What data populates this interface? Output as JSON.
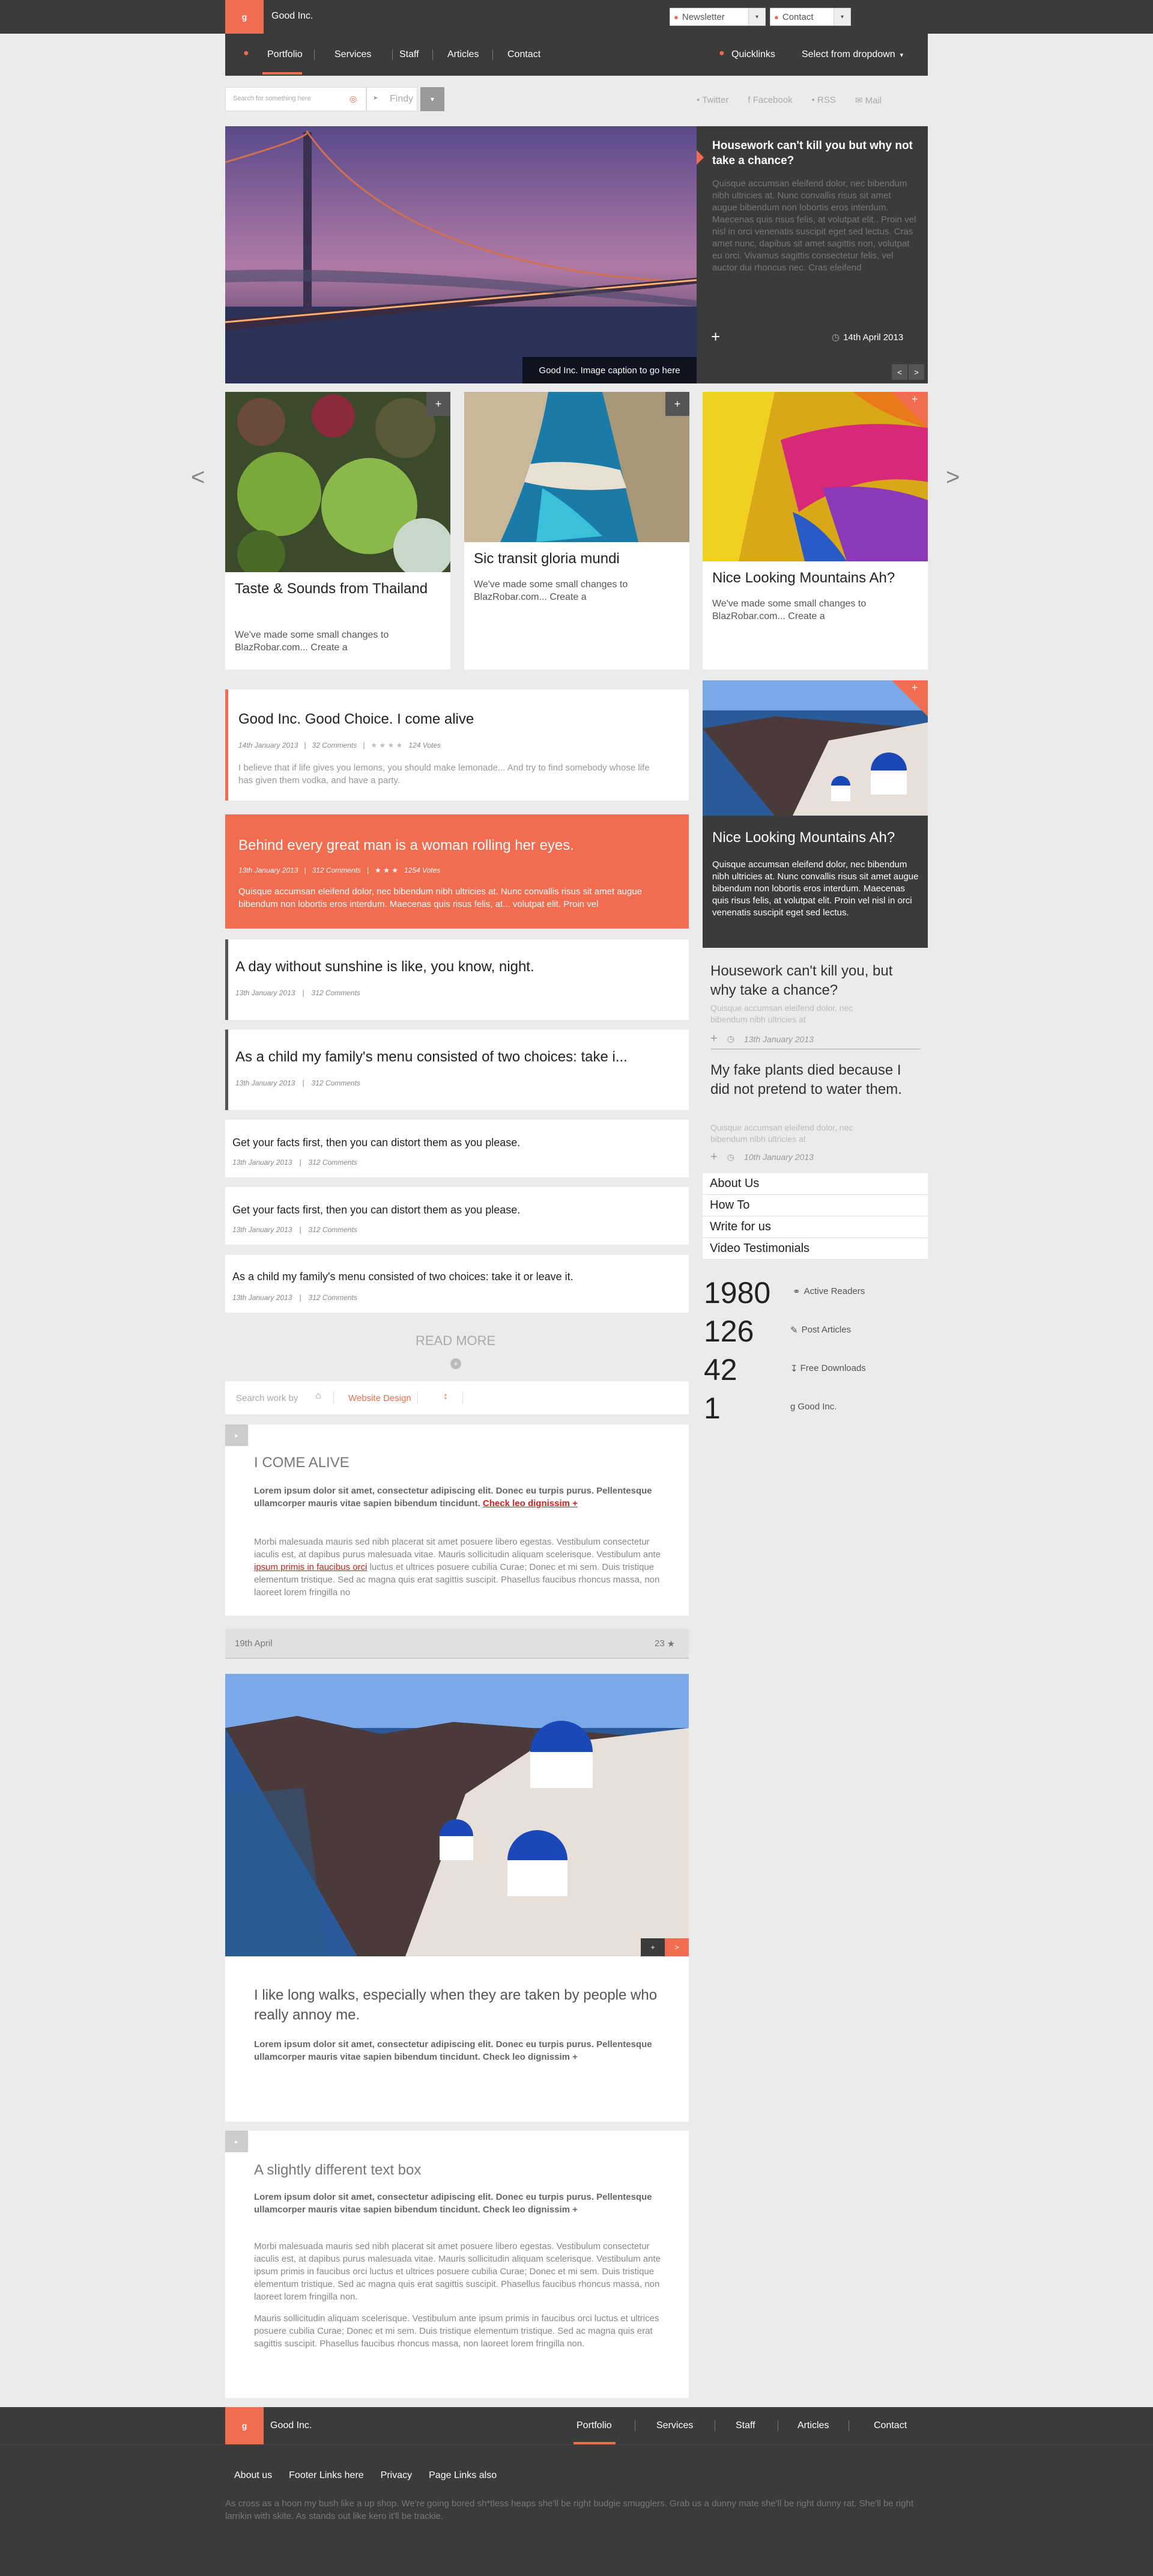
{
  "brand": {
    "name": "Good Inc.",
    "logo_letter": "g"
  },
  "topbar": {
    "newsletter": "Newsletter",
    "contact": "Contact"
  },
  "nav": {
    "items": [
      "Portfolio",
      "Services",
      "Staff",
      "Articles",
      "Contact"
    ],
    "quicklinks": "Quicklinks",
    "dropdown": "Select from dropdown"
  },
  "search": {
    "placeholder": "Search for something here",
    "findy": "Findy"
  },
  "social": [
    "Twitter",
    "Facebook",
    "RSS",
    "Mail"
  ],
  "hero": {
    "caption": "Good Inc. Image caption to go here",
    "side_title": "Housework can't kill you but why not take a chance?",
    "side_text": "Quisque accumsan eleifend dolor, nec bibendum nibh ultricies at. Nunc convallis risus sit amet augue bibendum non lobortis eros interdum. Maecenas quis risus felis, at volutpat elit.. Proin vel nisl in orci venenatis suscipit eget sed lectus. Cras amet nunc, dapibus sit amet sagittis non, volutpat eu orci. Vivamus sagittis consectetur felis, vel auctor dui rhoncus nec. Cras eleifend",
    "date": "14th April 2013"
  },
  "cards": [
    {
      "title": "Taste & Sounds from Thailand",
      "text": "We've made some small changes to BlazRobar.com... Create a"
    },
    {
      "title": "Sic transit gloria mundi",
      "text": "We've made some small changes to BlazRobar.com... Create a"
    },
    {
      "title": "Nice Looking Mountains Ah?",
      "text": "We've made some small changes to BlazRobar.com... Create a"
    }
  ],
  "posts": [
    {
      "title": "Good Inc. Good Choice. I come alive",
      "date": "14th January 2013",
      "comments": "32 Comments",
      "votes": "124 Votes",
      "text": "I believe that if life gives you lemons, you should make lemonade... And try to find somebody whose life has given them vodka, and have a party."
    },
    {
      "title": "Behind every great man is a woman rolling her eyes.",
      "date": "13th January 2013",
      "comments": "312 Comments",
      "votes": "1254 Votes",
      "text": "Quisque accumsan eleifend dolor, nec bibendum nibh ultricies at. Nunc convallis risus sit amet augue bibendum non lobortis eros interdum. Maecenas quis risus felis, at... volutpat elit. Proin vel"
    },
    {
      "title": "A day without sunshine is like, you know, night.",
      "date": "13th January 2013",
      "comments": "312 Comments"
    },
    {
      "title": "As a child my family's menu consisted of two choices: take i...",
      "date": "13th January 2013",
      "comments": "312 Comments"
    },
    {
      "title": "Get your facts first, then you can distort them as you please.",
      "date": "13th January 2013",
      "comments": "312 Comments"
    },
    {
      "title": "Get your facts first, then you can distort them as you please.",
      "date": "13th January 2013",
      "comments": "312 Comments"
    },
    {
      "title": "As a child my family's menu consisted of two choices: take it or leave it.",
      "date": "13th January 2013",
      "comments": "312 Comments"
    }
  ],
  "read_more": "READ MORE",
  "filter": {
    "label": "Search work by",
    "active": "Website Design"
  },
  "article1": {
    "title": "I COME ALIVE",
    "lead": "Lorem ipsum dolor sit amet, consectetur adipiscing elit. Donec eu turpis purus. Pellentesque ullamcorper mauris vitae sapien bibendum tincidunt.",
    "lead_link": "Check leo dignissim +",
    "body_a": "Morbi malesuada mauris sed nibh placerat sit amet posuere libero egestas. Vestibulum consectetur iaculis est, at dapibus purus malesuada vitae. Mauris sollicitudin aliquam scelerisque. Vestibulum ante",
    "body_link": "ipsum primis in faucibus orci",
    "body_b": "luctus et ultrices posuere cubilia Curae; Donec et mi sem. Duis tristique elementum tristique. Sed ac magna quis erat sagittis suscipit. Phasellus faucibus rhoncus massa, non laoreet lorem fringilla no",
    "date": "19th April",
    "count": "23"
  },
  "article2": {
    "quote": "I like long walks, especially when they are taken by people who really annoy me.",
    "lead": "Lorem ipsum dolor sit amet, consectetur adipiscing elit. Donec eu turpis purus. Pellentesque ullamcorper mauris vitae sapien bibendum tincidunt. Check leo dignissim +"
  },
  "article3": {
    "title": "A slightly different text box",
    "lead": "Lorem ipsum dolor sit amet, consectetur adipiscing elit. Donec eu turpis purus. Pellentesque ullamcorper mauris vitae sapien bibendum tincidunt. Check leo dignissim +",
    "body1": "Morbi malesuada mauris sed nibh placerat sit amet posuere libero egestas. Vestibulum consectetur iaculis est, at dapibus purus malesuada vitae. Mauris sollicitudin aliquam scelerisque. Vestibulum ante ipsum primis in faucibus orci luctus et ultrices posuere cubilia Curae; Donec et mi sem. Duis tristique elementum tristique. Sed ac magna quis erat sagittis suscipit. Phasellus faucibus rhoncus massa, non laoreet lorem fringilla non.",
    "body2": "Mauris sollicitudin aliquam scelerisque. Vestibulum ante ipsum primis in faucibus orci luctus et ultrices posuere cubilia Curae; Donec et mi sem. Duis tristique elementum tristique. Sed ac magna quis erat sagittis suscipit. Phasellus faucibus rhoncus massa, non laoreet lorem fringilla non."
  },
  "side": {
    "feature_title": "Nice Looking Mountains Ah?",
    "feature_text": "Quisque accumsan eleifend dolor, nec bibendum nibh ultricies at. Nunc convallis risus sit amet augue bibendum non lobortis eros interdum. Maecenas quis risus felis, at volutpat elit. Proin vel nisl in orci venenatis suscipit eget sed lectus.",
    "q1_title": "Housework can't kill you, but why take a chance?",
    "q1_text": "Quisque accumsan eleifend dolor, nec bibendum nibh ultricies at",
    "q1_date": "13th January 2013",
    "q2_title": "My fake plants died because I did not pretend to water them.",
    "q2_text": "Quisque accumsan eleifend dolor, nec bibendum nibh ultricies at",
    "q2_date": "10th January 2013",
    "links": [
      "About Us",
      "How To",
      "Write for us",
      "Video Testimonials"
    ],
    "stats": [
      {
        "num": "1980",
        "label": "Active Readers"
      },
      {
        "num": "126",
        "label": "Post Articles"
      },
      {
        "num": "42",
        "label": "Free Downloads"
      },
      {
        "num": "1",
        "label": "Good Inc."
      }
    ]
  },
  "footer": {
    "nav": [
      "Portfolio",
      "Services",
      "Staff",
      "Articles",
      "Contact"
    ],
    "links": [
      "About us",
      "Footer Links here",
      "Privacy",
      "Page Links also"
    ],
    "text": "As cross as a hoon my bush like a up shop. We're going bored sh*tless heaps she'll be right budgie smugglers. Grab us a dunny mate she'll be right dunny rat. She'll be right larrikin with skite. As stands out like kero it'll be trackie."
  },
  "colors": {
    "accent": "#f26c4f",
    "dark": "#3b3b3b"
  }
}
